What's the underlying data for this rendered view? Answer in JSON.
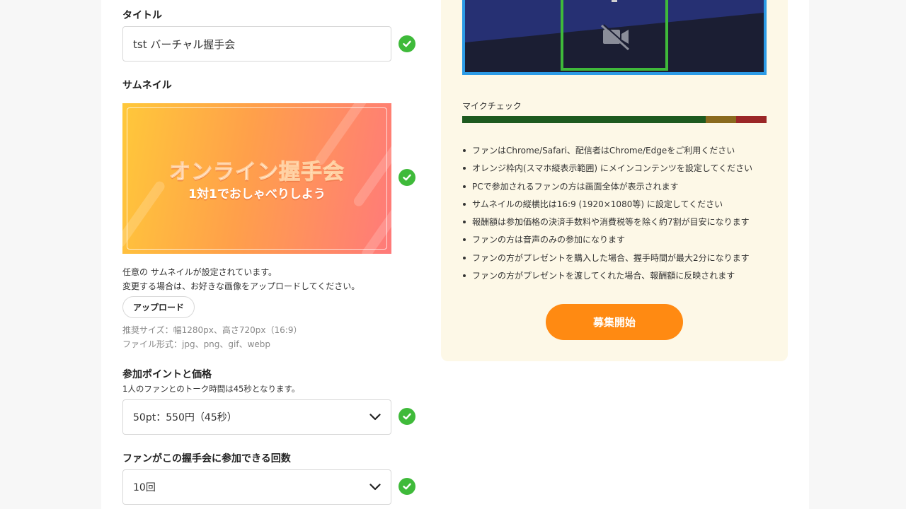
{
  "form": {
    "title_label": "タイトル",
    "title_value": "tst バーチャル握手会",
    "thumbnail_label": "サムネイル",
    "thumbnail_image": {
      "headline": "オンライン握手会",
      "subline": "1対1でおしゃべりしよう"
    },
    "thumbnail_status": "任意の サムネイルが設定されています。",
    "thumbnail_change_hint": "変更する場合は、お好きな画像をアップロードしてください。",
    "upload_label": "アップロード",
    "recommended_size": "推奨サイズ：幅1280px、高さ720px（16:9）",
    "file_format": "ファイル形式：jpg、png、gif、webp",
    "points_label": "参加ポイントと価格",
    "points_desc": "1人のファンとのトーク時間は45秒となります。",
    "points_value": "50pt：550円（45秒）",
    "times_label": "ファンがこの握手会に参加できる回数",
    "times_value": "10回"
  },
  "preview": {
    "mic_check_label": "マイクチェック",
    "meter": {
      "level_fraction": 0.8,
      "colors": [
        "#1d5a1f",
        "#8a6a1e",
        "#9b2727"
      ]
    },
    "notes": [
      "ファンはChrome/Safari、配信者はChrome/Edgeをご利用ください",
      "オレンジ枠内(スマホ縦表示範囲) にメインコンテンツを設定してください",
      "PCで参加されるファンの方は画面全体が表示されます",
      "サムネイルの縦横比は16:9 (1920×1080等) に設定してください",
      "報酬額は参加価格の決済手数料や消費税等を除く約7割が目安になります",
      "ファンの方は音声のみの参加になります",
      "ファンの方がプレゼントを購入した場合、握手時間が最大2分になります",
      "ファンの方がプレゼントを渡してくれた場合、報酬額に反映されます"
    ],
    "start_label": "募集開始"
  },
  "colors": {
    "check_green": "#3fba3a",
    "accent_orange": "#ff8a12",
    "video_border_blue": "#2c9be6",
    "video_frame_green": "#3fba3a",
    "panel_bg": "#fdf8e7"
  },
  "icons": {
    "valid": "check-circle-icon",
    "dropdown": "chevron-down-icon",
    "camera_off": "video-off-icon"
  }
}
